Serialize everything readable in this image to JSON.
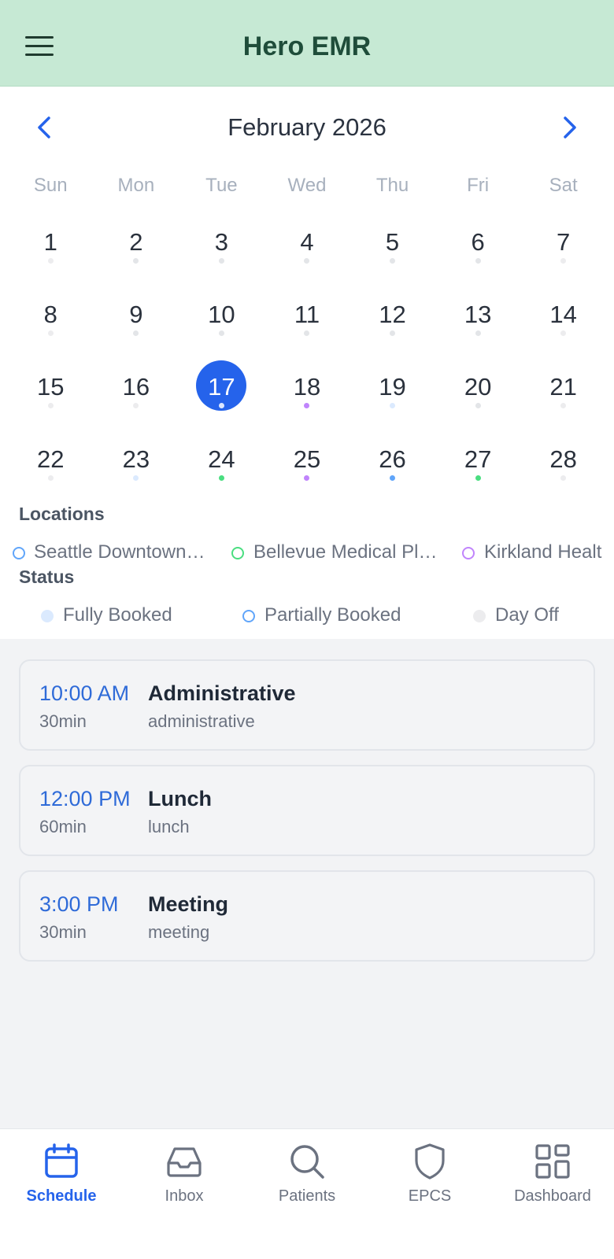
{
  "header": {
    "title": "Hero EMR"
  },
  "calendar": {
    "month_title": "February 2026",
    "weekdays": [
      "Sun",
      "Mon",
      "Tue",
      "Wed",
      "Thu",
      "Fri",
      "Sat"
    ],
    "selected_day": 17,
    "weeks": [
      [
        {
          "day": "1",
          "dot": "#ececee"
        },
        {
          "day": "2",
          "dot": "#e3e5e8"
        },
        {
          "day": "3",
          "dot": "#e3e5e8"
        },
        {
          "day": "4",
          "dot": "#e3e5e8"
        },
        {
          "day": "5",
          "dot": "#e3e5e8"
        },
        {
          "day": "6",
          "dot": "#e3e5e8"
        },
        {
          "day": "7",
          "dot": "#ececee"
        }
      ],
      [
        {
          "day": "8",
          "dot": "#ececee"
        },
        {
          "day": "9",
          "dot": "#e3e5e8"
        },
        {
          "day": "10",
          "dot": "#e3e5e8"
        },
        {
          "day": "11",
          "dot": "#e3e5e8"
        },
        {
          "day": "12",
          "dot": "#e3e5e8"
        },
        {
          "day": "13",
          "dot": "#e3e5e8"
        },
        {
          "day": "14",
          "dot": "#ececee"
        }
      ],
      [
        {
          "day": "15",
          "dot": "#ececee"
        },
        {
          "day": "16",
          "dot": "#ececee"
        },
        {
          "day": "17",
          "dot": "#dbe7ff"
        },
        {
          "day": "18",
          "dot": "#c084fc"
        },
        {
          "day": "19",
          "dot": "#dbeafe"
        },
        {
          "day": "20",
          "dot": "#e3e5e8"
        },
        {
          "day": "21",
          "dot": "#ececee"
        }
      ],
      [
        {
          "day": "22",
          "dot": "#ececee"
        },
        {
          "day": "23",
          "dot": "#dbeafe"
        },
        {
          "day": "24",
          "dot": "#4ade80"
        },
        {
          "day": "25",
          "dot": "#c084fc"
        },
        {
          "day": "26",
          "dot": "#60a5fa"
        },
        {
          "day": "27",
          "dot": "#4ade80"
        },
        {
          "day": "28",
          "dot": "#ececee"
        }
      ]
    ]
  },
  "legend": {
    "locations_title": "Locations",
    "locations": [
      {
        "label": "Seattle Downtown…",
        "color": "#60a5fa"
      },
      {
        "label": "Bellevue Medical Pl…",
        "color": "#4ade80"
      },
      {
        "label": "Kirkland Healt",
        "color": "#c084fc"
      }
    ],
    "status_title": "Status",
    "statuses": [
      {
        "label": "Fully Booked",
        "color": "#dbeafe",
        "style": "filled"
      },
      {
        "label": "Partially Booked",
        "color": "#60a5fa",
        "style": "ring"
      },
      {
        "label": "Day Off",
        "color": "#ececee",
        "style": "filled"
      }
    ]
  },
  "appointments": [
    {
      "time": "10:00 AM",
      "duration": "30min",
      "title": "Administrative",
      "subtitle": "administrative"
    },
    {
      "time": "12:00 PM",
      "duration": "60min",
      "title": "Lunch",
      "subtitle": "lunch"
    },
    {
      "time": "3:00 PM",
      "duration": "30min",
      "title": "Meeting",
      "subtitle": "meeting"
    }
  ],
  "tabs": [
    {
      "label": "Schedule",
      "icon": "calendar-icon",
      "active": true
    },
    {
      "label": "Inbox",
      "icon": "inbox-icon",
      "active": false
    },
    {
      "label": "Patients",
      "icon": "search-icon",
      "active": false
    },
    {
      "label": "EPCS",
      "icon": "shield-icon",
      "active": false
    },
    {
      "label": "Dashboard",
      "icon": "grid-icon",
      "active": false
    }
  ],
  "colors": {
    "accent": "#2563eb",
    "header_bg": "#c6e9d4"
  }
}
